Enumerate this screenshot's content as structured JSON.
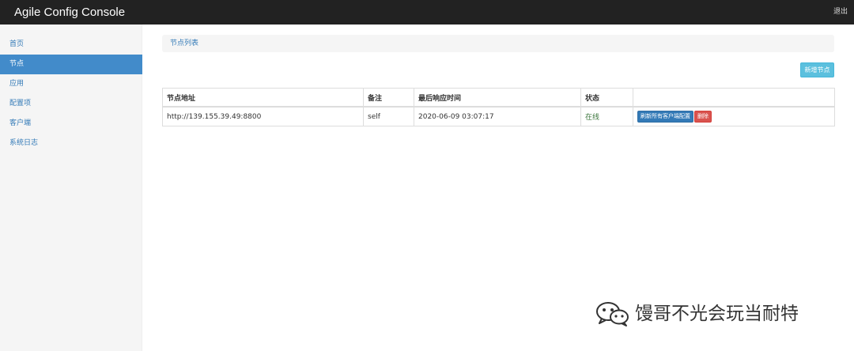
{
  "header": {
    "title": "Agile Config Console",
    "logout_label": "退出"
  },
  "sidebar": {
    "items": [
      {
        "label": "首页",
        "active": false
      },
      {
        "label": "节点",
        "active": true
      },
      {
        "label": "应用",
        "active": false
      },
      {
        "label": "配置项",
        "active": false
      },
      {
        "label": "客户端",
        "active": false
      },
      {
        "label": "系统日志",
        "active": false
      }
    ]
  },
  "breadcrumb": {
    "label": "节点列表"
  },
  "toolbar": {
    "new_node_label": "新增节点"
  },
  "table": {
    "columns": [
      "节点地址",
      "备注",
      "最后响应时间",
      "状态",
      ""
    ],
    "rows": [
      {
        "address": "http://139.155.39.49:8800",
        "remark": "self",
        "last_response": "2020-06-09 03:07:17",
        "status": "在线",
        "actions": {
          "refresh_label": "刷新所有客户端配置",
          "delete_label": "删除"
        }
      }
    ]
  },
  "watermark": {
    "text": "馒哥不光会玩当耐特",
    "icon": "wechat-icon"
  },
  "colors": {
    "navbar": "#222222",
    "sidebar_active": "#428bca",
    "link": "#337ab7",
    "info_button": "#5bc0de",
    "primary_button": "#337ab7",
    "danger_button": "#d9534f",
    "status_online": "#3c763d"
  }
}
